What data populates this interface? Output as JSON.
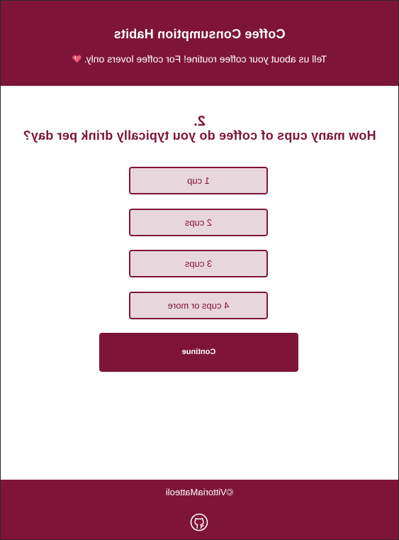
{
  "header": {
    "title": "Coffee Consumption Habits",
    "subtitle": "Tell us about your coffee routine! For coffee lovers only.",
    "subtitle_icon": "heart-icon"
  },
  "question": {
    "number": "2.",
    "text": "How many cups of coffee do you typically drink per day?",
    "options": [
      "1 cup",
      "2 cups",
      "3 cups",
      "4 cups or more"
    ]
  },
  "continue_label": "Continue",
  "footer": {
    "credit": "©VittoriaMatteoli",
    "icon": "github-icon"
  },
  "colors": {
    "brand": "#7f1439",
    "option_bg": "#e8d6dd",
    "text_on_brand": "#ffffff"
  }
}
